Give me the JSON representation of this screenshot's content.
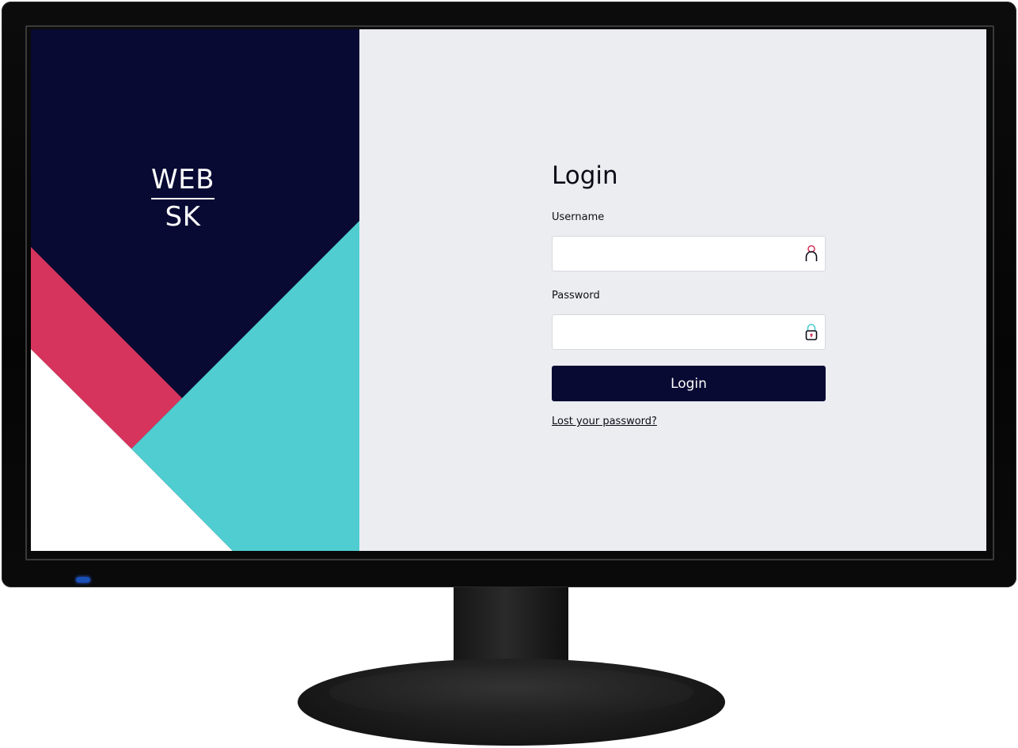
{
  "brand": {
    "logo_top": "WEB",
    "logo_bottom": "SK",
    "colors": {
      "navy": "#080a33",
      "pink": "#d6345c",
      "teal": "#50cdd0",
      "white": "#ffffff"
    }
  },
  "login": {
    "title": "Login",
    "username_label": "Username",
    "username_icon": "user-icon",
    "password_label": "Password",
    "password_icon": "lock-icon",
    "submit_label": "Login",
    "lost_password_link": "Lost your password?"
  }
}
